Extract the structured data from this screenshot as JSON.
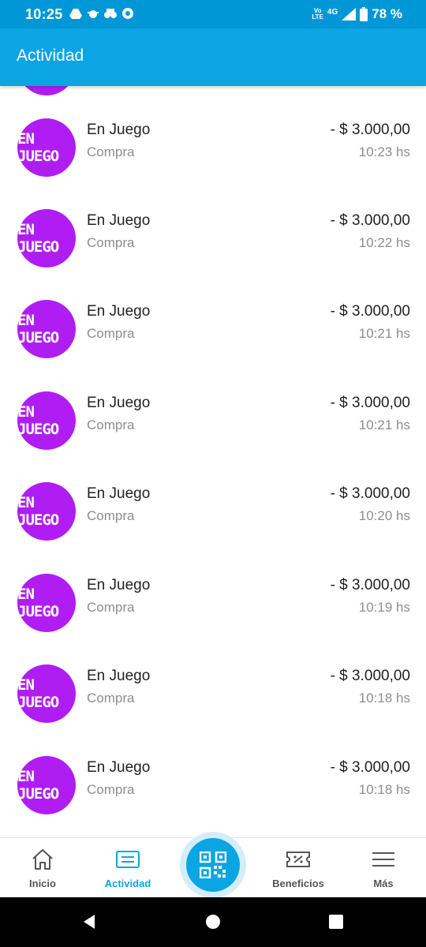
{
  "status_bar": {
    "time": "10:25",
    "volte": "Vo\nLTE",
    "network": "4G",
    "battery": "78 %",
    "notification_icons": [
      "drive-icon",
      "bug-icon",
      "binoculars-icon",
      "chrome-icon"
    ]
  },
  "app_bar": {
    "title": "Actividad"
  },
  "activity": {
    "items": [
      {
        "logo": "EN JUEGO",
        "name": "En Juego",
        "type": "Compra",
        "amount": "- $ 3.000,00",
        "time": "10:23 hs"
      },
      {
        "logo": "EN JUEGO",
        "name": "En Juego",
        "type": "Compra",
        "amount": "- $ 3.000,00",
        "time": "10:22 hs"
      },
      {
        "logo": "EN JUEGO",
        "name": "En Juego",
        "type": "Compra",
        "amount": "- $ 3.000,00",
        "time": "10:21 hs"
      },
      {
        "logo": "EN JUEGO",
        "name": "En Juego",
        "type": "Compra",
        "amount": "- $ 3.000,00",
        "time": "10:21 hs"
      },
      {
        "logo": "EN JUEGO",
        "name": "En Juego",
        "type": "Compra",
        "amount": "- $ 3.000,00",
        "time": "10:20 hs"
      },
      {
        "logo": "EN JUEGO",
        "name": "En Juego",
        "type": "Compra",
        "amount": "- $ 3.000,00",
        "time": "10:19 hs"
      },
      {
        "logo": "EN JUEGO",
        "name": "En Juego",
        "type": "Compra",
        "amount": "- $ 3.000,00",
        "time": "10:18 hs"
      },
      {
        "logo": "EN JUEGO",
        "name": "En Juego",
        "type": "Compra",
        "amount": "- $ 3.000,00",
        "time": "10:18 hs"
      }
    ]
  },
  "bottom_nav": {
    "inicio": "Inicio",
    "actividad": "Actividad",
    "beneficios": "Beneficios",
    "mas": "Más",
    "active": "actividad"
  },
  "colors": {
    "primary": "#0ba5e4",
    "status_bar": "#0097d6",
    "merchant_avatar": "#b01df2"
  }
}
